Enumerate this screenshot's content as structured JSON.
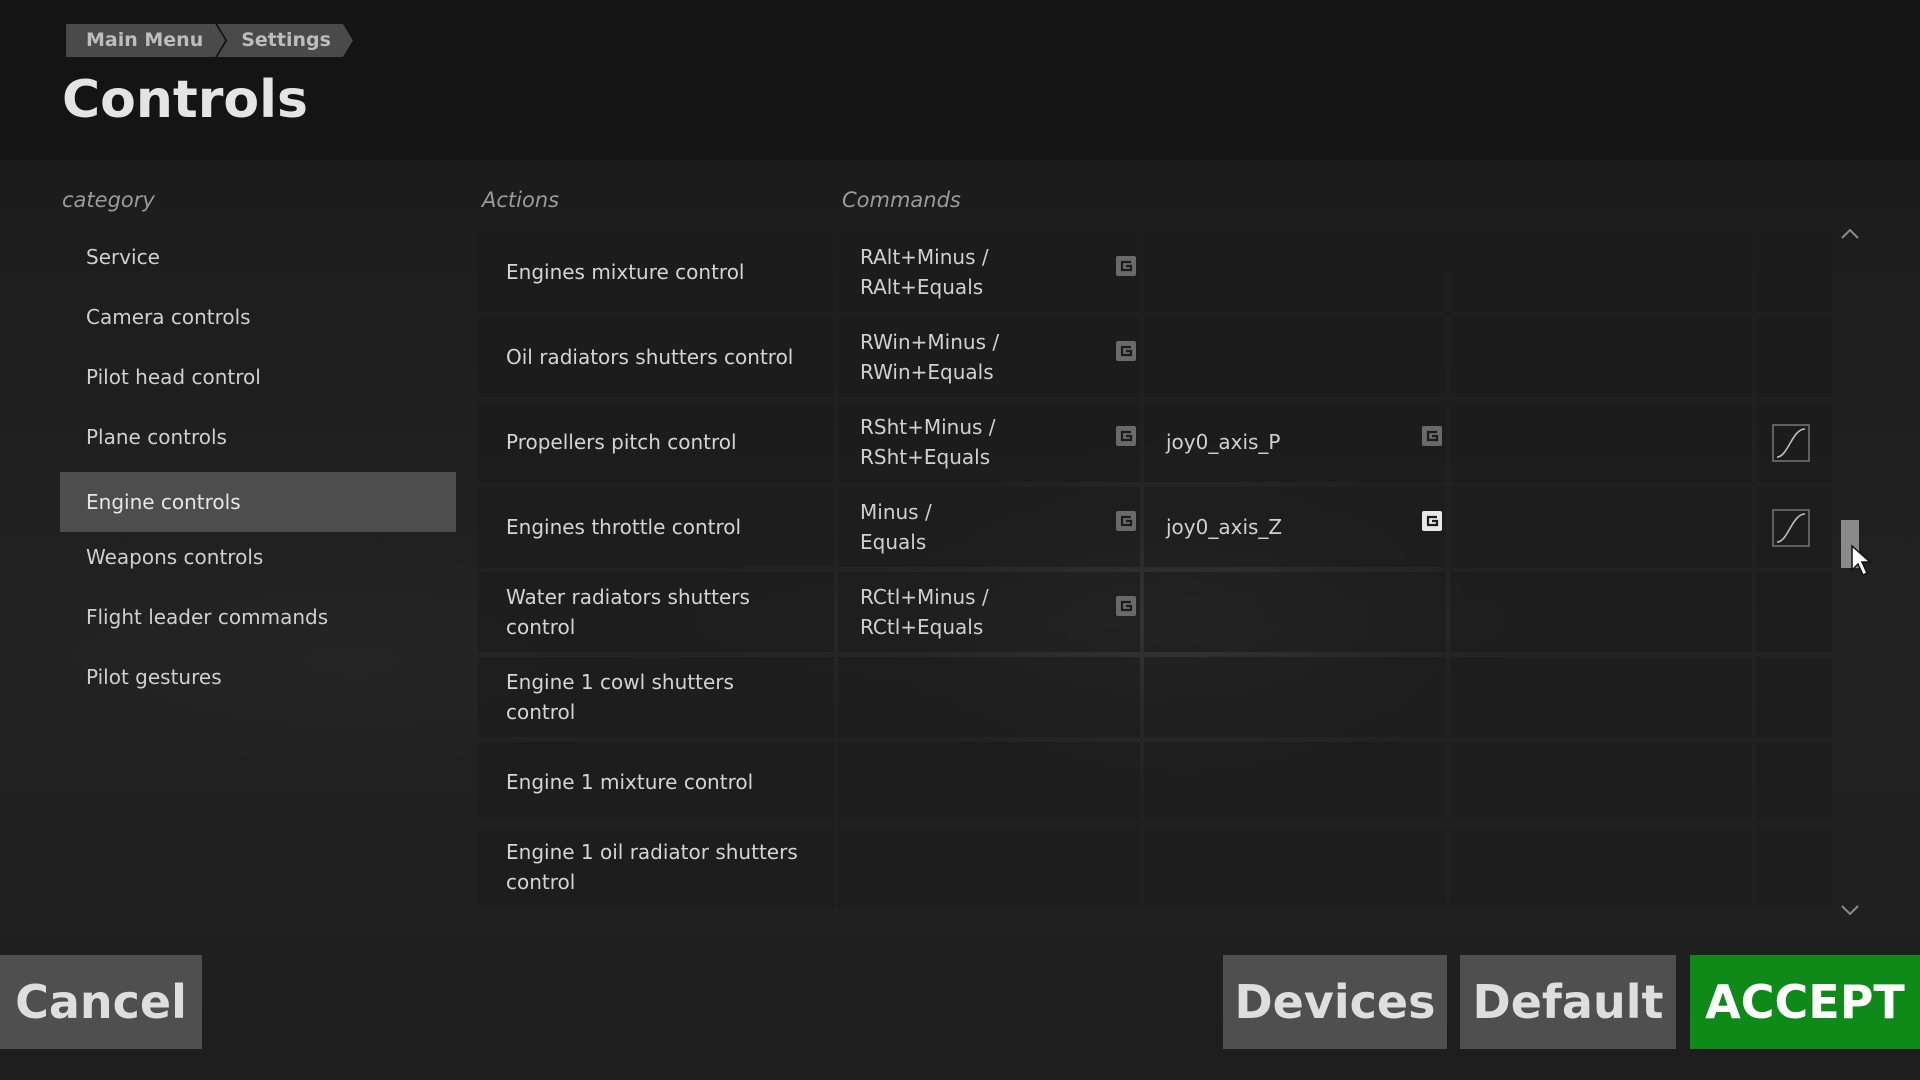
{
  "breadcrumb": [
    "Main Menu",
    "Settings"
  ],
  "page_title": "Controls",
  "headers": {
    "category": "category",
    "actions": "Actions",
    "commands": "Commands"
  },
  "categories": [
    "Service",
    "Camera controls",
    "Pilot head control",
    "Plane controls",
    "Engine controls",
    "Weapons controls",
    "Flight leader commands",
    "Pilot gestures"
  ],
  "selected_category": "Engine controls",
  "rows": [
    {
      "action": "Engines mixture control",
      "cmd1": [
        "RAlt+Minus /",
        "RAlt+Equals"
      ],
      "cmd2": "",
      "curve": false
    },
    {
      "action": "Oil radiators shutters control",
      "cmd1": [
        "RWin+Minus /",
        "RWin+Equals"
      ],
      "cmd2": "",
      "curve": false
    },
    {
      "action": "Propellers pitch control",
      "cmd1": [
        "RSht+Minus /",
        "RSht+Equals"
      ],
      "cmd2": "joy0_axis_P",
      "curve": true
    },
    {
      "action": "Engines throttle control",
      "cmd1": [
        "Minus /",
        "Equals"
      ],
      "cmd2": "joy0_axis_Z",
      "curve": true
    },
    {
      "action": "Water radiators shutters control",
      "cmd1": [
        "RCtl+Minus /",
        "RCtl+Equals"
      ],
      "cmd2": "",
      "curve": false
    },
    {
      "action": "Engine 1 cowl shutters control",
      "cmd1": [],
      "cmd2": "",
      "curve": false
    },
    {
      "action": "Engine 1 mixture control",
      "cmd1": [],
      "cmd2": "",
      "curve": false
    },
    {
      "action": "Engine 1 oil radiator shutters control",
      "cmd1": [],
      "cmd2": "",
      "curve": false
    }
  ],
  "buttons": {
    "cancel": "Cancel",
    "devices": "Devices",
    "default": "Default",
    "accept": "ACCEPT"
  },
  "colors": {
    "accept": "#0d8a18",
    "selected_row": "#4d4d4d",
    "button": "#4f4f4f"
  }
}
